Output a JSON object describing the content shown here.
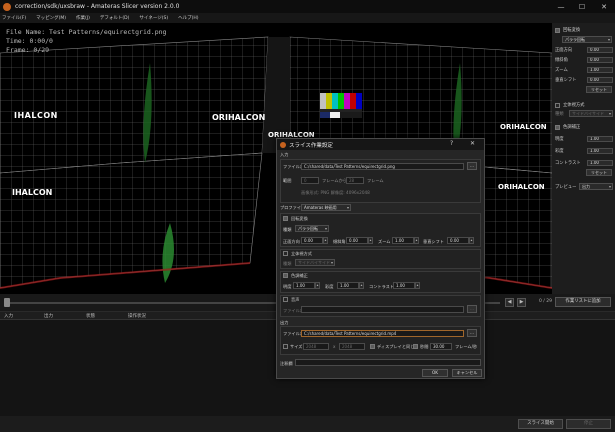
{
  "window": {
    "title": "correction/sdk/uxsbraw - Amateras Slicer version 2.0.0",
    "min_icon": "—",
    "max_icon": "☐",
    "close_icon": "✕"
  },
  "menu": [
    "ファイル(F)",
    "マッピング(M)",
    "作業(J)",
    "デフォルト(D)",
    "サイネージ(S)",
    "ヘルプ(H)"
  ],
  "viewer": {
    "file_name": "File Name: Test Patterns/equirectgrid.png",
    "time": "Time: 0:00/0",
    "frame": "Frame: 0/29",
    "brand": "ORIHALCON",
    "brand_short": "IHALCON"
  },
  "right_panel": {
    "orientation_section": "回転変換",
    "orientation_mode": "パララ回転",
    "rows1": [
      {
        "label": "正面方向",
        "value": "0.00"
      },
      {
        "label": "傾斜角",
        "value": "0.00"
      },
      {
        "label": "ズーム",
        "value": "1.00"
      },
      {
        "label": "垂直シフト",
        "value": "0.00"
      }
    ],
    "reset1": "リセット",
    "stereo_section": "立体視方式",
    "stereo_label": "種類",
    "stereo_mode": "サイドバイサイド",
    "color_section": "色調補正",
    "rows2": [
      {
        "label": "明度",
        "value": "1.00"
      },
      {
        "label": "彩度",
        "value": "1.00"
      },
      {
        "label": "コントラスト",
        "value": "1.00"
      }
    ],
    "reset2": "リセット",
    "preview_label": "プレビュー",
    "preview_value": "出力"
  },
  "timeline": {
    "frame": "0 / 29",
    "add_job": "作業リストに追加",
    "prev_icon": "◀",
    "next_icon": "▶"
  },
  "queue": {
    "columns": [
      "入力",
      "出力",
      "状態",
      "操作状況"
    ]
  },
  "bottom": {
    "start": "スライス開始",
    "stop": "停止"
  },
  "dialog": {
    "title": "スライス作業設定",
    "help_icon": "?",
    "close_icon": "✕",
    "input_section": "入力",
    "file_label": "ファイル名",
    "file_value": "C:/shared/data/Test Patterns/equirectgrid.png",
    "browse": "…",
    "range_label": "範囲",
    "range_from": "0",
    "range_from_unit": "フレームから",
    "range_to": "28",
    "range_to_unit": "フレーム",
    "info_text": "画像形式: PNG 解像度: 4096x2048",
    "profile_label": "プロファイル",
    "profile_value": "Amateras 映画用",
    "orient_section": "回転変換",
    "orient_type_label": "種類",
    "orient_type": "パララ回転",
    "orient_fields": [
      {
        "label": "正面方向",
        "value": "0.00"
      },
      {
        "label": "傾斜角",
        "value": "0.00"
      },
      {
        "label": "ズーム",
        "value": "1.00"
      },
      {
        "label": "垂直シフト",
        "value": "0.00"
      }
    ],
    "stereo_section": "立体視方式",
    "stereo_type_label": "種類",
    "stereo_type": "サイドバイサイド",
    "color_section": "色調補正",
    "color_fields": [
      {
        "label": "明度",
        "value": "1.00"
      },
      {
        "label": "彩度",
        "value": "1.00"
      },
      {
        "label": "コントラスト",
        "value": "1.00"
      }
    ],
    "audio_section": "音声",
    "audio_file_label": "ファイル名",
    "output_section": "出力",
    "out_file_label": "ファイル名",
    "out_file_value": "C:/shared/data/Test Patterns/equirectgrid.mp4",
    "size_label": "サイズ",
    "size_w": "2048",
    "size_x": "x",
    "size_h": "2048",
    "display_label": "ディスプレイと同じ",
    "fps_label": "秒間",
    "fps_value": "30.00",
    "fps_unit": "フレーム/秒",
    "notes_label": "注釈欄",
    "ok": "OK",
    "cancel": "キャンセル"
  },
  "colors": {
    "accent": "#c6621e",
    "background": "#1e1e1e",
    "viewer_bg": "#000000"
  }
}
